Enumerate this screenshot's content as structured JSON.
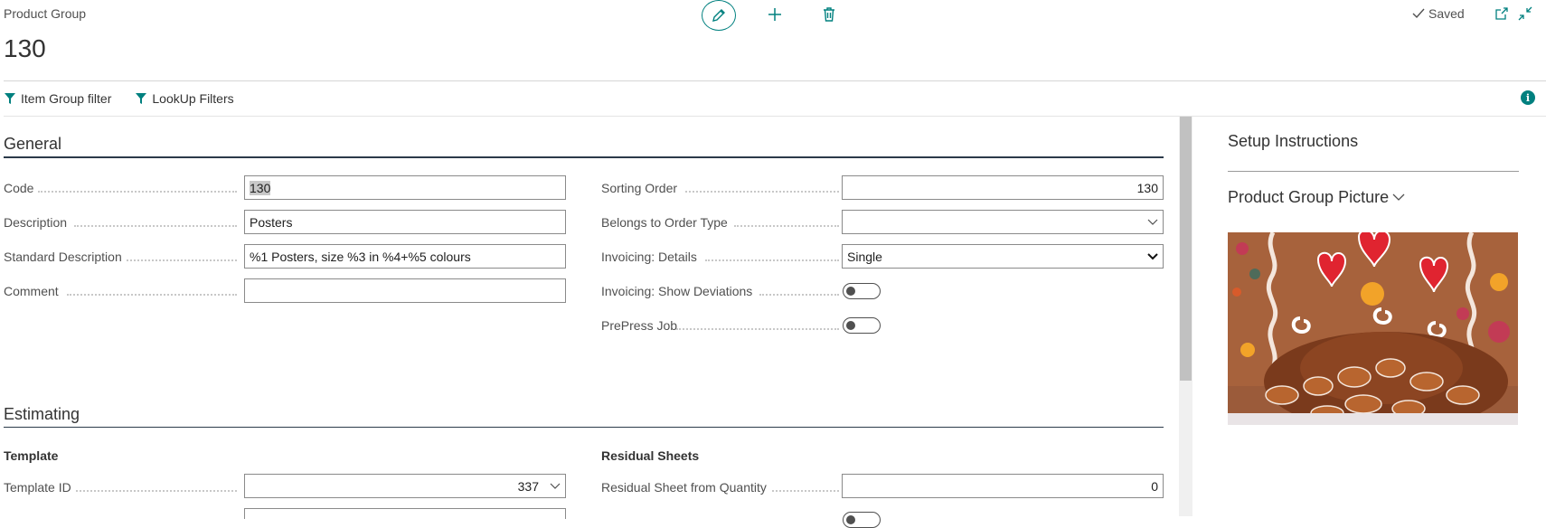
{
  "header": {
    "breadcrumb": "Product Group",
    "title": "130",
    "saved_label": "Saved"
  },
  "filters": [
    {
      "label": "Item Group filter"
    },
    {
      "label": "LookUp Filters"
    }
  ],
  "general": {
    "title": "General",
    "left": [
      {
        "label": "Code",
        "value": "130"
      },
      {
        "label": "Description",
        "value": "Posters"
      },
      {
        "label": "Standard Description",
        "value": "%1 Posters, size %3 in %4+%5 colours"
      },
      {
        "label": "Comment",
        "value": ""
      }
    ],
    "right": [
      {
        "label": "Sorting Order",
        "value": "130"
      },
      {
        "label": "Belongs to Order Type",
        "value": ""
      },
      {
        "label": "Invoicing: Details",
        "value": "Single"
      },
      {
        "label": "Invoicing: Show Deviations",
        "value": false
      },
      {
        "label": "PrePress Job",
        "value": false
      }
    ]
  },
  "estimating": {
    "title": "Estimating",
    "template_group": "Template",
    "residual_group": "Residual Sheets",
    "template_id": {
      "label": "Template ID",
      "value": "337"
    },
    "residual_from_qty": {
      "label": "Residual Sheet from Quantity",
      "value": "0"
    }
  },
  "sidebar": {
    "setup_instructions": "Setup Instructions",
    "picture_title": "Product Group Picture"
  },
  "colors": {
    "accent": "#00807f",
    "section_line": "#2b3a4a"
  }
}
